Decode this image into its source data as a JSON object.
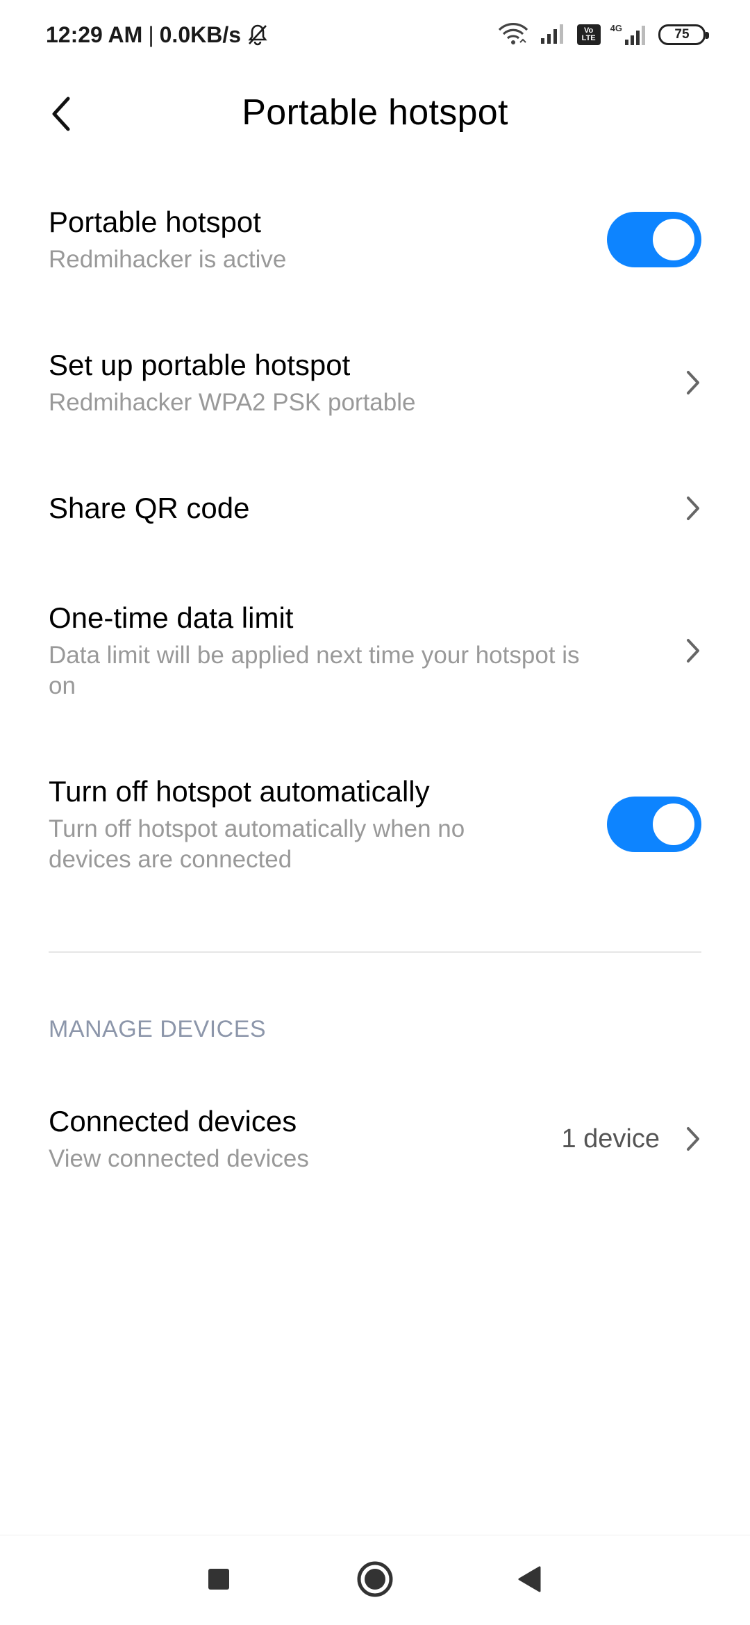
{
  "status_bar": {
    "time": "12:29 AM",
    "separator": "|",
    "speed": "0.0KB/s",
    "volte_top": "Vo",
    "volte_bottom": "LTE",
    "network_type": "4G",
    "battery": "75"
  },
  "header": {
    "title": "Portable hotspot"
  },
  "settings": [
    {
      "title": "Portable hotspot",
      "subtitle": "Redmihacker is active",
      "control": "toggle",
      "toggle_on": true
    },
    {
      "title": "Set up portable hotspot",
      "subtitle": "Redmihacker WPA2 PSK portable",
      "control": "chevron"
    },
    {
      "title": "Share QR code",
      "subtitle": "",
      "control": "chevron"
    },
    {
      "title": "One-time data limit",
      "subtitle_line1": "Data limit will be applied next time your hotspot is",
      "subtitle_line2": "on",
      "control": "chevron"
    },
    {
      "title": "Turn off hotspot automatically",
      "subtitle_line1": "Turn off hotspot automatically when no",
      "subtitle_line2": "devices are connected",
      "control": "toggle",
      "toggle_on": true
    }
  ],
  "manage_devices": {
    "section_label": "MANAGE DEVICES",
    "connected": {
      "title": "Connected devices",
      "subtitle": "View connected devices",
      "value": "1 device"
    }
  },
  "colors": {
    "accent": "#0d84ff",
    "secondary_text": "#999999",
    "section_label": "#8c96aa"
  },
  "icons": [
    "mute-bell-icon",
    "wifi-icon",
    "signal-icon",
    "volte-icon",
    "battery-icon",
    "back-arrow-icon",
    "chevron-right-icon",
    "recents-square-icon",
    "home-circle-icon",
    "back-triangle-icon"
  ]
}
